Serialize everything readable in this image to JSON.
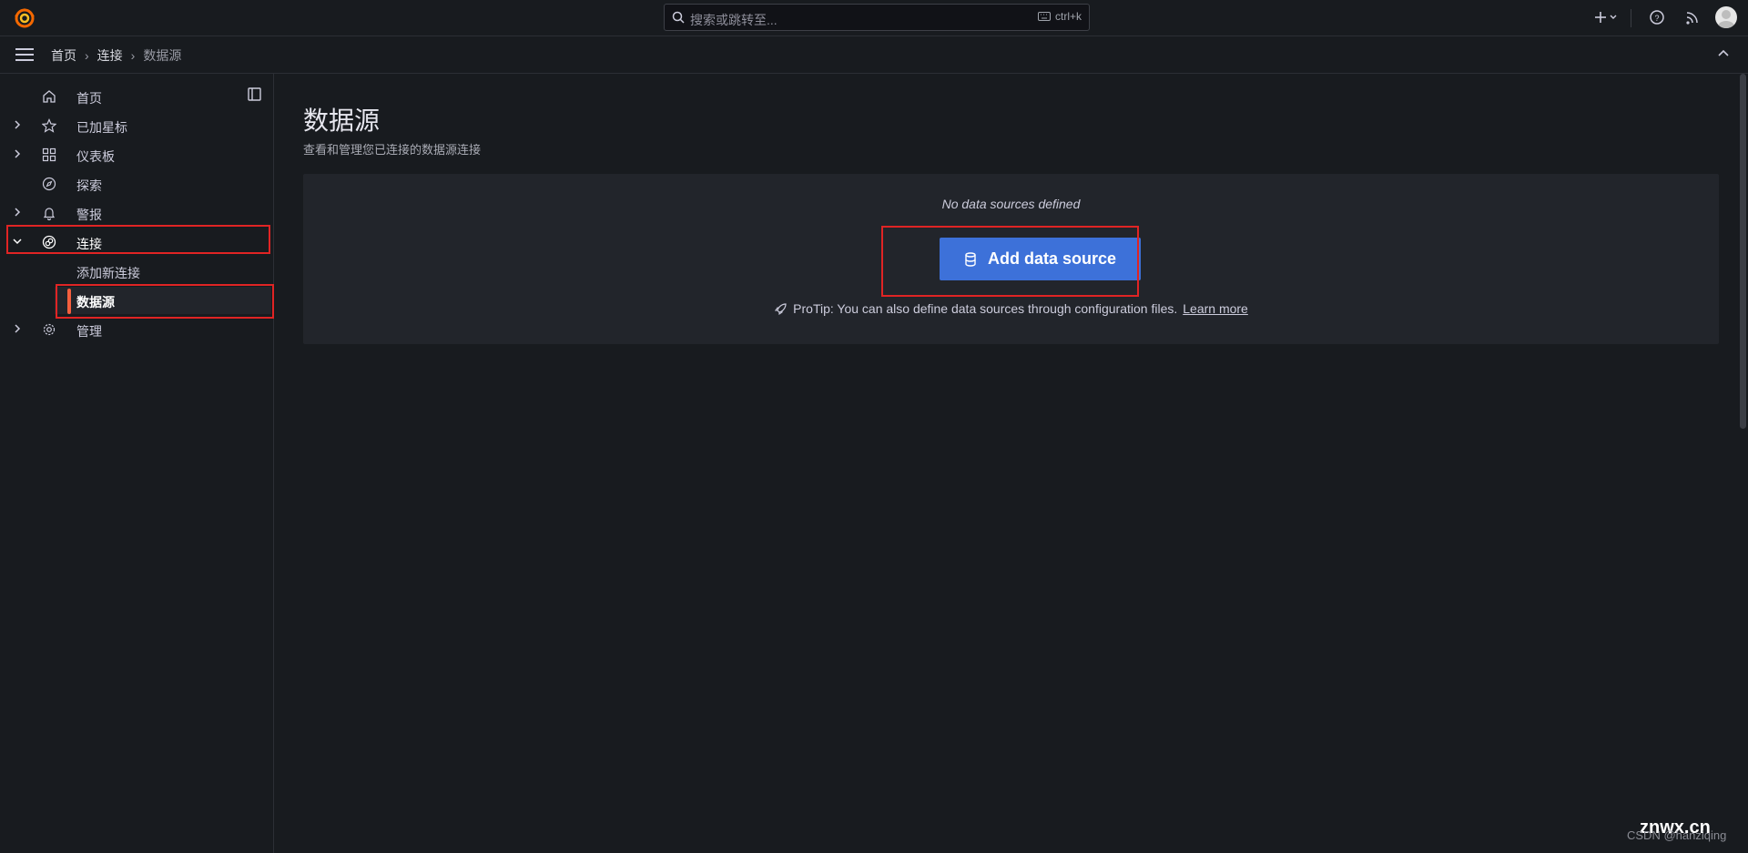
{
  "search": {
    "placeholder": "搜索或跳转至...",
    "shortcut": "ctrl+k"
  },
  "breadcrumb": [
    {
      "label": "首页"
    },
    {
      "label": "连接"
    },
    {
      "label": "数据源"
    }
  ],
  "breadcrumb_sep": "›",
  "sidebar": {
    "items": [
      {
        "label": "首页",
        "icon": "home-icon"
      },
      {
        "label": "已加星标",
        "icon": "star-icon"
      },
      {
        "label": "仪表板",
        "icon": "apps-icon"
      },
      {
        "label": "探索",
        "icon": "compass-icon"
      },
      {
        "label": "警报",
        "icon": "bell-icon"
      },
      {
        "label": "连接",
        "icon": "link-icon"
      },
      {
        "label": "管理",
        "icon": "cog-icon"
      }
    ],
    "sub_items": [
      {
        "label": "添加新连接"
      },
      {
        "label": "数据源"
      }
    ]
  },
  "main": {
    "title": "数据源",
    "subtitle": "查看和管理您已连接的数据源连接",
    "empty_message": "No data sources defined",
    "add_button": "Add data source",
    "protip": "ProTip: You can also define data sources through configuration files.",
    "learn_more": "Learn more"
  },
  "watermark": {
    "znwx": "znwx.cn",
    "csdn": "CSDN @hanziqing"
  },
  "colors": {
    "primary": "#3d71d9",
    "accent_orange": "#f55f3e",
    "highlight": "#e02424",
    "bg": "#181b1f"
  }
}
